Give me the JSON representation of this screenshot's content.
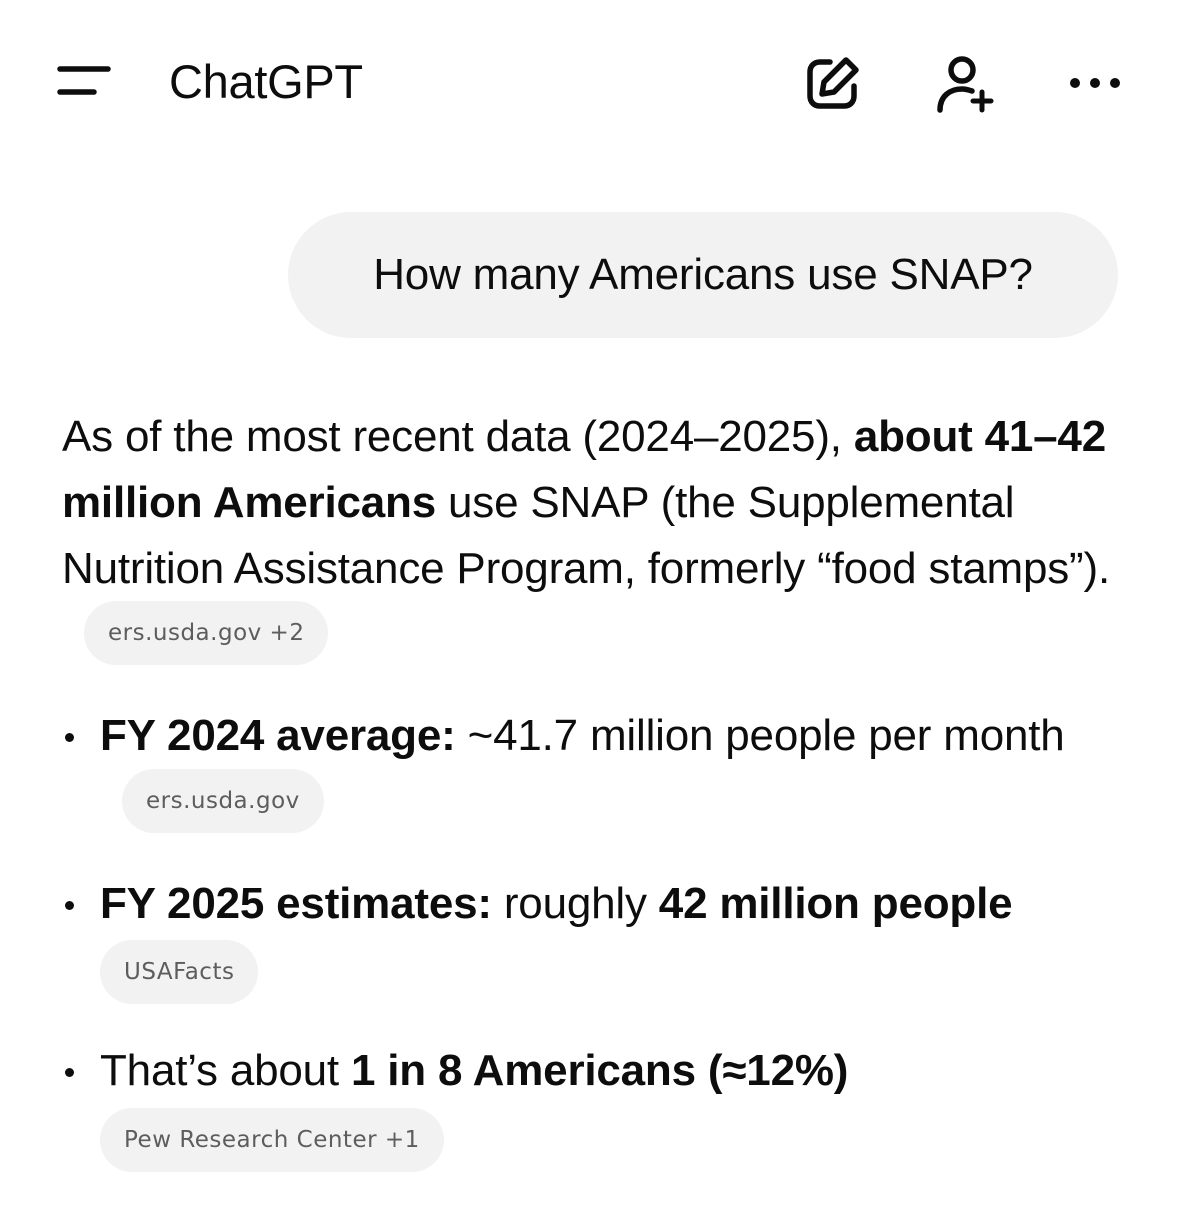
{
  "header": {
    "title": "ChatGPT",
    "icons": [
      "menu-icon",
      "new-chat-icon",
      "add-person-icon",
      "more-icon"
    ]
  },
  "conversation": {
    "user_message": "How many Americans use SNAP?",
    "response": {
      "intro_1": "As of the most recent data (2024–2025), ",
      "intro_bold": "about 41–42 million Americans",
      "intro_2": " use SNAP (the Supplemental Nutrition Assistance Program, formerly “food stamps”).",
      "intro_source": "ers.usda.gov +2",
      "bullets": [
        {
          "bold": "FY 2024 average:",
          "text": " ~41.7 million people per month",
          "source": "ers.usda.gov"
        },
        {
          "bold": "FY 2025 estimates:",
          "text": " roughly ",
          "bold2": "42 million people",
          "source": "USAFacts"
        },
        {
          "text": "That’s about ",
          "bold": "1 in 8 Americans (≈12%)",
          "source": "Pew Research Center +1"
        }
      ]
    }
  },
  "colors": {
    "text": "#0d0d0d",
    "bubble_bg": "#f2f2f2",
    "chip_text": "#5d5d5d"
  }
}
